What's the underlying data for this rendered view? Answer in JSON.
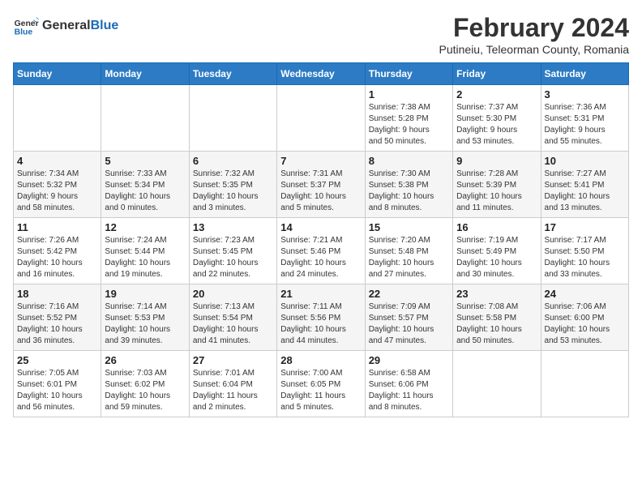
{
  "header": {
    "logo_general": "General",
    "logo_blue": "Blue",
    "month_title": "February 2024",
    "subtitle": "Putineiu, Teleorman County, Romania"
  },
  "weekdays": [
    "Sunday",
    "Monday",
    "Tuesday",
    "Wednesday",
    "Thursday",
    "Friday",
    "Saturday"
  ],
  "weeks": [
    [
      {
        "day": "",
        "info": ""
      },
      {
        "day": "",
        "info": ""
      },
      {
        "day": "",
        "info": ""
      },
      {
        "day": "",
        "info": ""
      },
      {
        "day": "1",
        "info": "Sunrise: 7:38 AM\nSunset: 5:28 PM\nDaylight: 9 hours\nand 50 minutes."
      },
      {
        "day": "2",
        "info": "Sunrise: 7:37 AM\nSunset: 5:30 PM\nDaylight: 9 hours\nand 53 minutes."
      },
      {
        "day": "3",
        "info": "Sunrise: 7:36 AM\nSunset: 5:31 PM\nDaylight: 9 hours\nand 55 minutes."
      }
    ],
    [
      {
        "day": "4",
        "info": "Sunrise: 7:34 AM\nSunset: 5:32 PM\nDaylight: 9 hours\nand 58 minutes."
      },
      {
        "day": "5",
        "info": "Sunrise: 7:33 AM\nSunset: 5:34 PM\nDaylight: 10 hours\nand 0 minutes."
      },
      {
        "day": "6",
        "info": "Sunrise: 7:32 AM\nSunset: 5:35 PM\nDaylight: 10 hours\nand 3 minutes."
      },
      {
        "day": "7",
        "info": "Sunrise: 7:31 AM\nSunset: 5:37 PM\nDaylight: 10 hours\nand 5 minutes."
      },
      {
        "day": "8",
        "info": "Sunrise: 7:30 AM\nSunset: 5:38 PM\nDaylight: 10 hours\nand 8 minutes."
      },
      {
        "day": "9",
        "info": "Sunrise: 7:28 AM\nSunset: 5:39 PM\nDaylight: 10 hours\nand 11 minutes."
      },
      {
        "day": "10",
        "info": "Sunrise: 7:27 AM\nSunset: 5:41 PM\nDaylight: 10 hours\nand 13 minutes."
      }
    ],
    [
      {
        "day": "11",
        "info": "Sunrise: 7:26 AM\nSunset: 5:42 PM\nDaylight: 10 hours\nand 16 minutes."
      },
      {
        "day": "12",
        "info": "Sunrise: 7:24 AM\nSunset: 5:44 PM\nDaylight: 10 hours\nand 19 minutes."
      },
      {
        "day": "13",
        "info": "Sunrise: 7:23 AM\nSunset: 5:45 PM\nDaylight: 10 hours\nand 22 minutes."
      },
      {
        "day": "14",
        "info": "Sunrise: 7:21 AM\nSunset: 5:46 PM\nDaylight: 10 hours\nand 24 minutes."
      },
      {
        "day": "15",
        "info": "Sunrise: 7:20 AM\nSunset: 5:48 PM\nDaylight: 10 hours\nand 27 minutes."
      },
      {
        "day": "16",
        "info": "Sunrise: 7:19 AM\nSunset: 5:49 PM\nDaylight: 10 hours\nand 30 minutes."
      },
      {
        "day": "17",
        "info": "Sunrise: 7:17 AM\nSunset: 5:50 PM\nDaylight: 10 hours\nand 33 minutes."
      }
    ],
    [
      {
        "day": "18",
        "info": "Sunrise: 7:16 AM\nSunset: 5:52 PM\nDaylight: 10 hours\nand 36 minutes."
      },
      {
        "day": "19",
        "info": "Sunrise: 7:14 AM\nSunset: 5:53 PM\nDaylight: 10 hours\nand 39 minutes."
      },
      {
        "day": "20",
        "info": "Sunrise: 7:13 AM\nSunset: 5:54 PM\nDaylight: 10 hours\nand 41 minutes."
      },
      {
        "day": "21",
        "info": "Sunrise: 7:11 AM\nSunset: 5:56 PM\nDaylight: 10 hours\nand 44 minutes."
      },
      {
        "day": "22",
        "info": "Sunrise: 7:09 AM\nSunset: 5:57 PM\nDaylight: 10 hours\nand 47 minutes."
      },
      {
        "day": "23",
        "info": "Sunrise: 7:08 AM\nSunset: 5:58 PM\nDaylight: 10 hours\nand 50 minutes."
      },
      {
        "day": "24",
        "info": "Sunrise: 7:06 AM\nSunset: 6:00 PM\nDaylight: 10 hours\nand 53 minutes."
      }
    ],
    [
      {
        "day": "25",
        "info": "Sunrise: 7:05 AM\nSunset: 6:01 PM\nDaylight: 10 hours\nand 56 minutes."
      },
      {
        "day": "26",
        "info": "Sunrise: 7:03 AM\nSunset: 6:02 PM\nDaylight: 10 hours\nand 59 minutes."
      },
      {
        "day": "27",
        "info": "Sunrise: 7:01 AM\nSunset: 6:04 PM\nDaylight: 11 hours\nand 2 minutes."
      },
      {
        "day": "28",
        "info": "Sunrise: 7:00 AM\nSunset: 6:05 PM\nDaylight: 11 hours\nand 5 minutes."
      },
      {
        "day": "29",
        "info": "Sunrise: 6:58 AM\nSunset: 6:06 PM\nDaylight: 11 hours\nand 8 minutes."
      },
      {
        "day": "",
        "info": ""
      },
      {
        "day": "",
        "info": ""
      }
    ]
  ]
}
